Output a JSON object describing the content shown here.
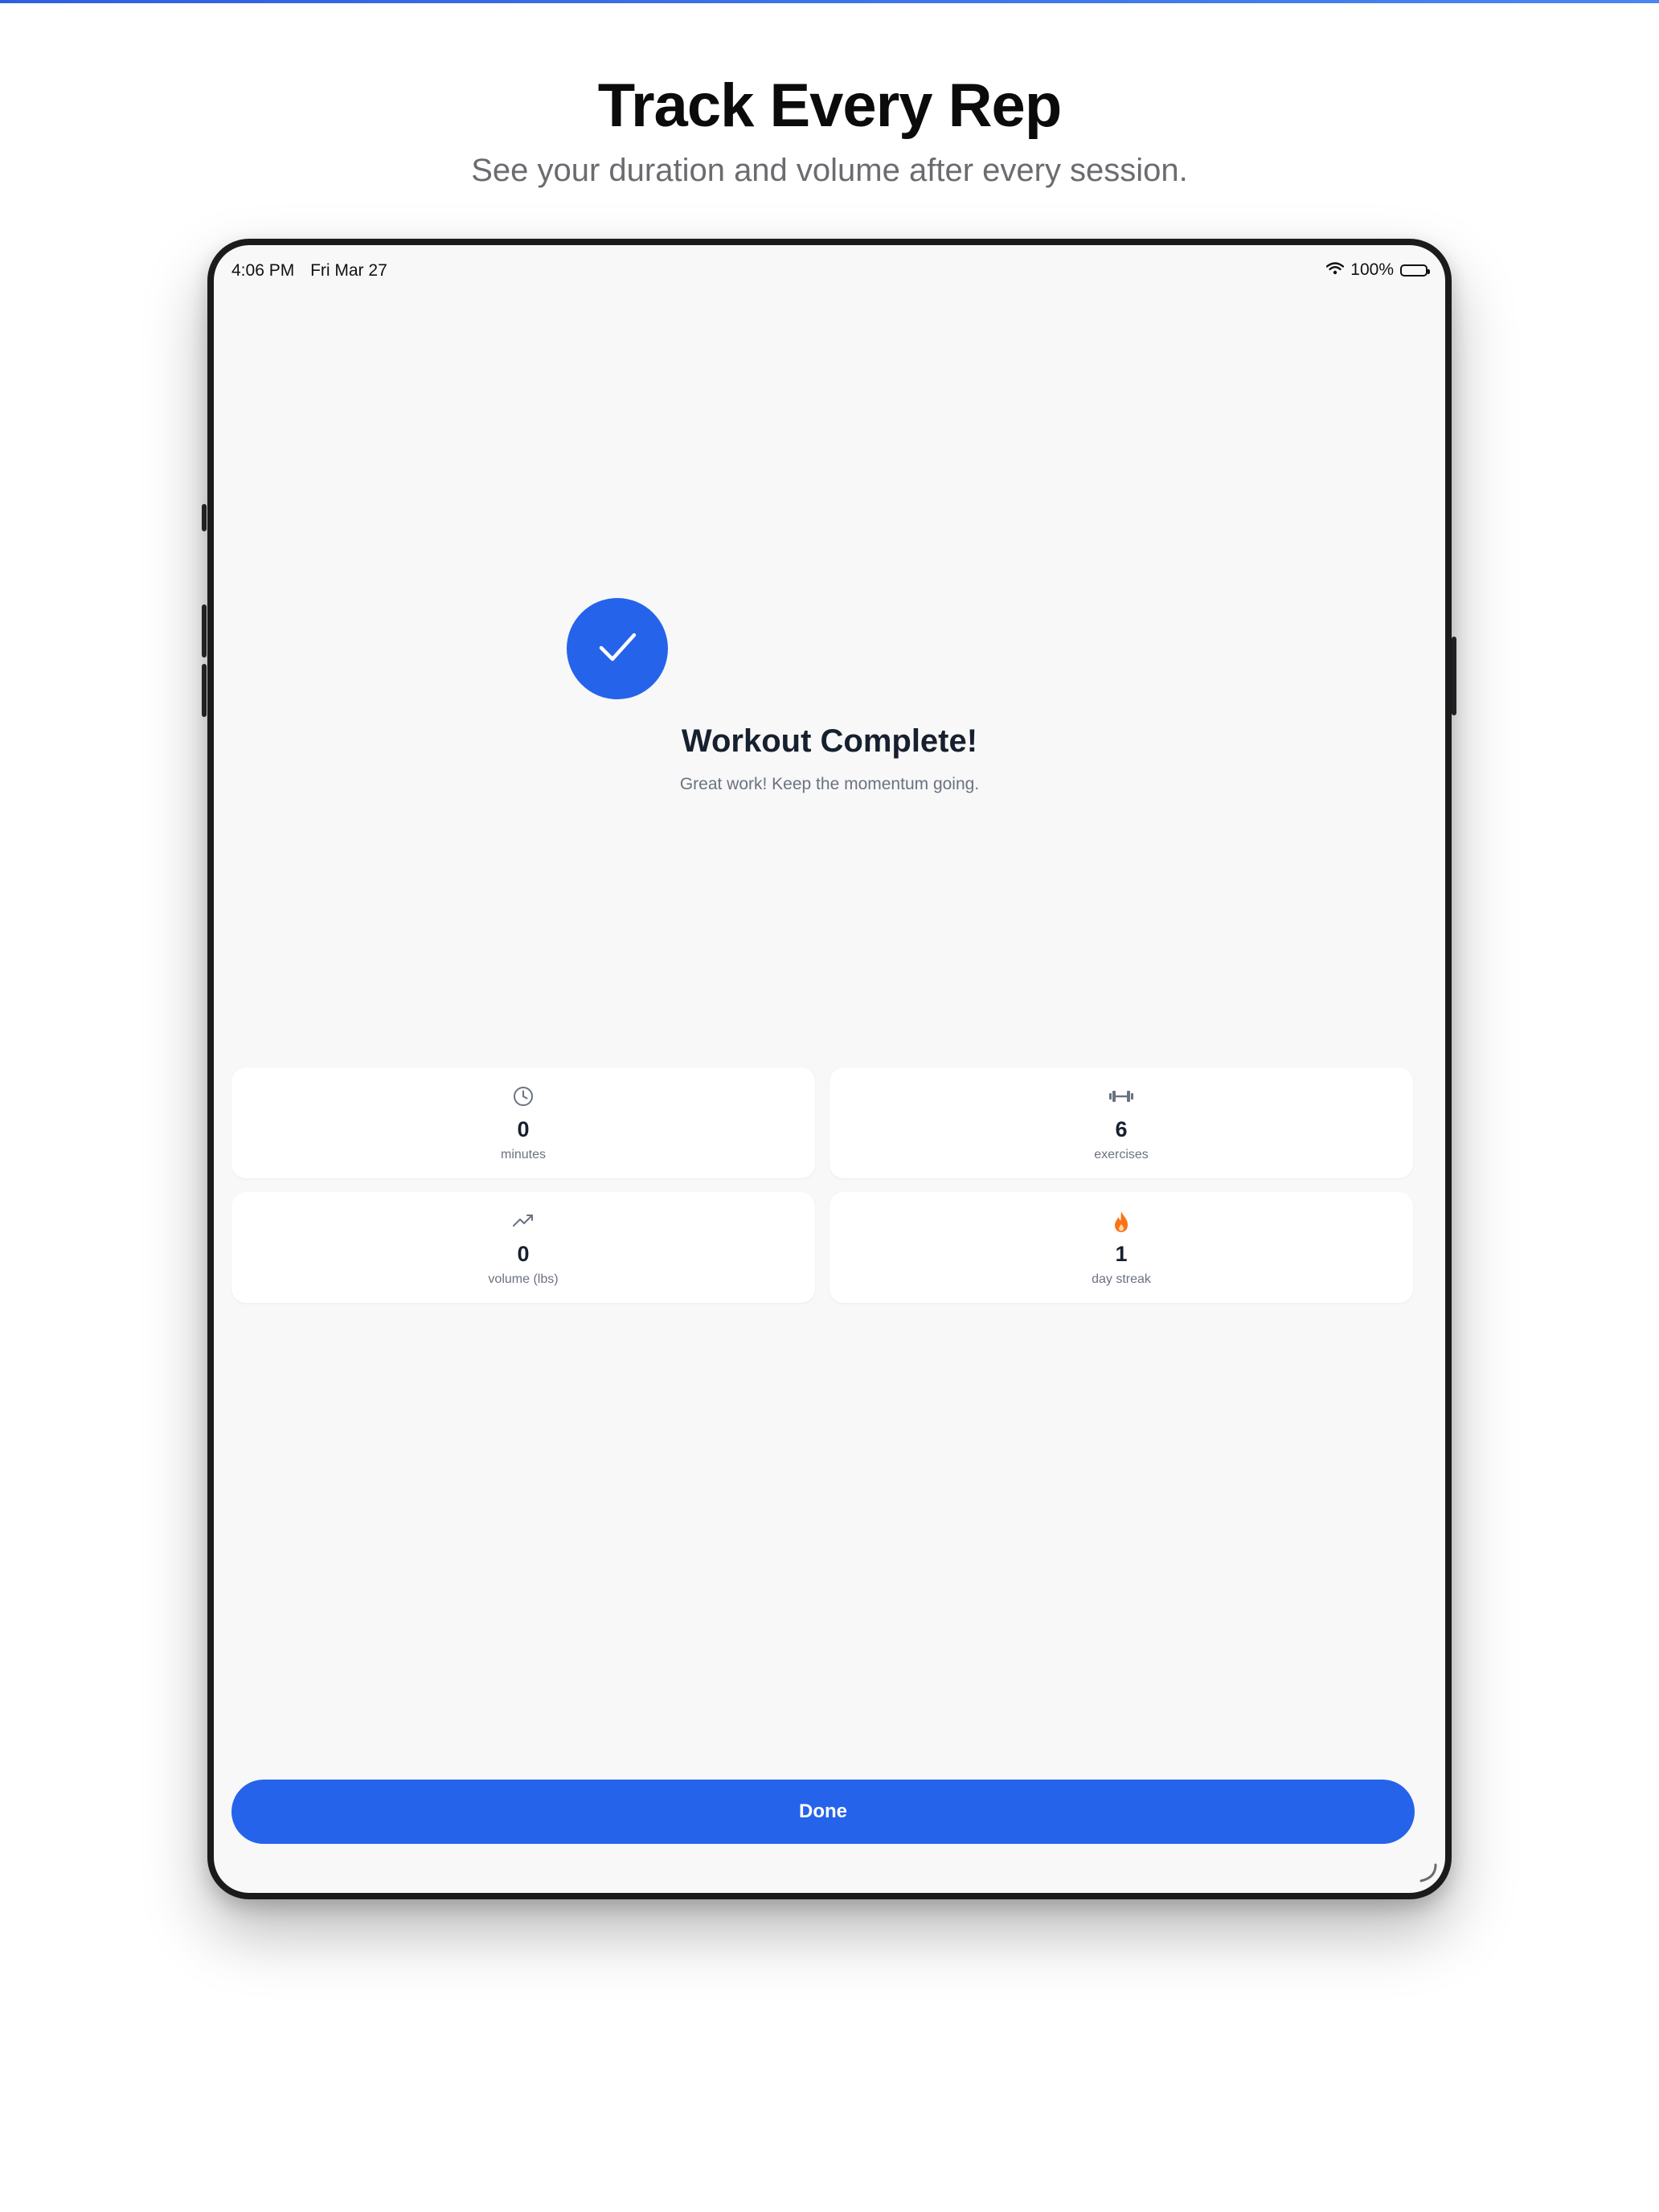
{
  "promo": {
    "headline": "Track Every Rep",
    "subhead": "See your duration and volume after every session."
  },
  "status_bar": {
    "time": "4:06 PM",
    "date": "Fri Mar 27",
    "battery": "100%",
    "battery_level": 1.0
  },
  "completion": {
    "icon": "checkmark-icon",
    "title": "Workout Complete!",
    "subtitle": "Great work! Keep the momentum going."
  },
  "stats": [
    {
      "icon": "clock-icon",
      "value": "0",
      "label": "minutes"
    },
    {
      "icon": "dumbbell-icon",
      "value": "6",
      "label": "exercises"
    },
    {
      "icon": "trend-up-icon",
      "value": "0",
      "label": "volume (lbs)"
    },
    {
      "icon": "flame-icon",
      "value": "1",
      "label": "day streak"
    }
  ],
  "actions": {
    "done_label": "Done"
  },
  "colors": {
    "accent": "#2563eb",
    "text_dark": "#17202e",
    "text_muted": "#6b7280",
    "flame": "#f97316",
    "background": "#f8f8f8"
  }
}
